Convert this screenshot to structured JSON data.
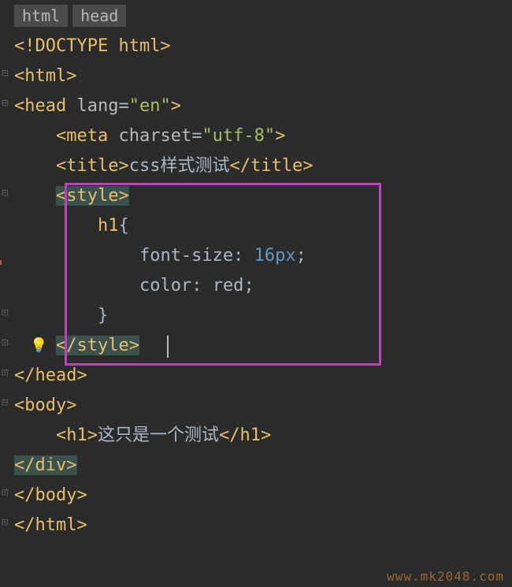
{
  "breadcrumb": {
    "items": [
      "html",
      "head"
    ]
  },
  "code": {
    "line1": "<!DOCTYPE html>",
    "line2_open": "<",
    "line2_tag": "html",
    "line2_close": ">",
    "line3_open": "<",
    "line3_tag": "head ",
    "line3_attr": "lang",
    "line3_eq": "=",
    "line3_val": "\"en\"",
    "line3_close": ">",
    "line4_indent": "    ",
    "line4_open": "<",
    "line4_tag": "meta ",
    "line4_attr": "charset",
    "line4_eq": "=",
    "line4_val": "\"utf-8\"",
    "line4_close": ">",
    "line5_indent": "    ",
    "line5_open": "<",
    "line5_tag": "title",
    "line5_close1": ">",
    "line5_text": "css样式测试",
    "line5_open2": "</",
    "line5_tag2": "title",
    "line5_close2": ">",
    "line6_indent": "    ",
    "line6_open": "<",
    "line6_tag": "style",
    "line6_close": ">",
    "line7_indent": "        ",
    "line7_sel": "h1",
    "line7_brace": "{",
    "line8_indent": "            ",
    "line8_prop": "font-size",
    "line8_colon": ": ",
    "line8_val": "16",
    "line8_unit": "px",
    "line8_semi": ";",
    "line9_indent": "            ",
    "line9_prop": "color",
    "line9_colon": ": ",
    "line9_val": "red",
    "line9_semi": ";",
    "line10_indent": "        ",
    "line10_brace": "}",
    "line11_indent": "    ",
    "line11_open": "</",
    "line11_tag": "style",
    "line11_close": ">",
    "line12_open": "</",
    "line12_tag": "head",
    "line12_close": ">",
    "line13_open": "<",
    "line13_tag": "body",
    "line13_close": ">",
    "line14_indent": "    ",
    "line14_open": "<",
    "line14_tag": "h1",
    "line14_close1": ">",
    "line14_text": "这只是一个测试",
    "line14_open2": "</",
    "line14_tag2": "h1",
    "line14_close2": ">",
    "line15_open": "</",
    "line15_tag": "div",
    "line15_close": ">",
    "line16_open": "</",
    "line16_tag": "body",
    "line16_close": ">",
    "line17_open": "</",
    "line17_tag": "html",
    "line17_close": ">"
  },
  "watermark": "www.mk2048.com"
}
